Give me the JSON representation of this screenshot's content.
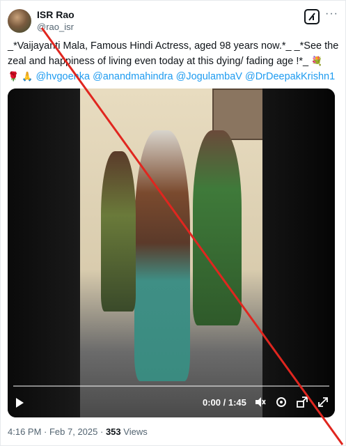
{
  "author": {
    "name": "ISR Rao",
    "handle": "@rao_isr"
  },
  "post": {
    "text_line1": "_*Vaijayanti Mala, Famous Hindi Actress, aged 98 years now.*_  _*See the",
    "text_line2": "zeal and happiness of living even today at this dying/ fading age !*_",
    "emoji_flowers": "💐",
    "emoji_rose": "🌹",
    "emoji_pray": "🙏",
    "mentions": [
      "@hvgoenka",
      "@anandmahindra",
      "@JogulambaV",
      "@DrDeepakKrishn1"
    ]
  },
  "video": {
    "time": "0:00 / 1:45",
    "progress": 0
  },
  "meta": {
    "time": "4:16 PM",
    "date": "Feb 7, 2025",
    "views_count": "353",
    "views_label": "Views"
  },
  "icons": [
    "grok-icon",
    "more-icon",
    "play-icon",
    "volume-icon",
    "settings-icon",
    "minimize-icon",
    "fullscreen-icon"
  ],
  "colors": {
    "link": "#1d9bf0",
    "strike": "#e0261f",
    "secondary": "#536471"
  }
}
